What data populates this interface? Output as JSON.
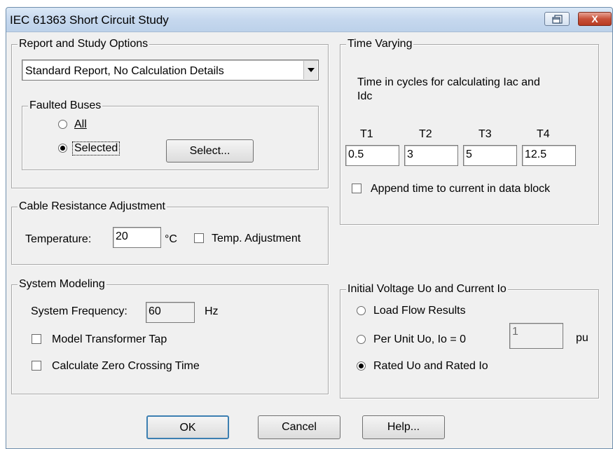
{
  "window": {
    "title": "IEC 61363 Short Circuit Study",
    "restore_icon": "restore-icon",
    "close_label": "X"
  },
  "report": {
    "legend": "Report and Study Options",
    "dropdown_value": "Standard Report, No Calculation Details",
    "faulted": {
      "legend": "Faulted Buses",
      "option_all": "All",
      "option_selected": "Selected",
      "selected_value": "Selected",
      "select_button": "Select..."
    }
  },
  "cable": {
    "legend": "Cable Resistance Adjustment",
    "temperature_label": "Temperature:",
    "temperature_value": "20",
    "temperature_unit": "°C",
    "temp_adjust_label": "Temp. Adjustment",
    "temp_adjust_checked": false
  },
  "system": {
    "legend": "System Modeling",
    "frequency_label": "System Frequency:",
    "frequency_value": "60",
    "frequency_unit": "Hz",
    "transformer_tap_label": "Model Transformer Tap",
    "transformer_tap_checked": false,
    "zero_crossing_label": "Calculate Zero Crossing Time",
    "zero_crossing_checked": false
  },
  "time_varying": {
    "legend": "Time Varying",
    "description_line1": "Time in cycles for calculating Iac and",
    "description_line2": "Idc",
    "fields": [
      {
        "label": "T1",
        "value": "0.5"
      },
      {
        "label": "T2",
        "value": "3"
      },
      {
        "label": "T3",
        "value": "5"
      },
      {
        "label": "T4",
        "value": "12.5"
      }
    ],
    "append_label": "Append time to current in data block",
    "append_checked": false
  },
  "initial_voltage": {
    "legend": "Initial Voltage Uo and Current Io",
    "option_load_flow": "Load Flow Results",
    "option_per_unit": "Per Unit Uo, Io = 0",
    "option_rated": "Rated Uo and Rated Io",
    "selected_value": "Rated Uo and Rated Io",
    "per_unit_value": "1",
    "per_unit_unit": "pu"
  },
  "buttons": {
    "ok": "OK",
    "cancel": "Cancel",
    "help": "Help..."
  }
}
